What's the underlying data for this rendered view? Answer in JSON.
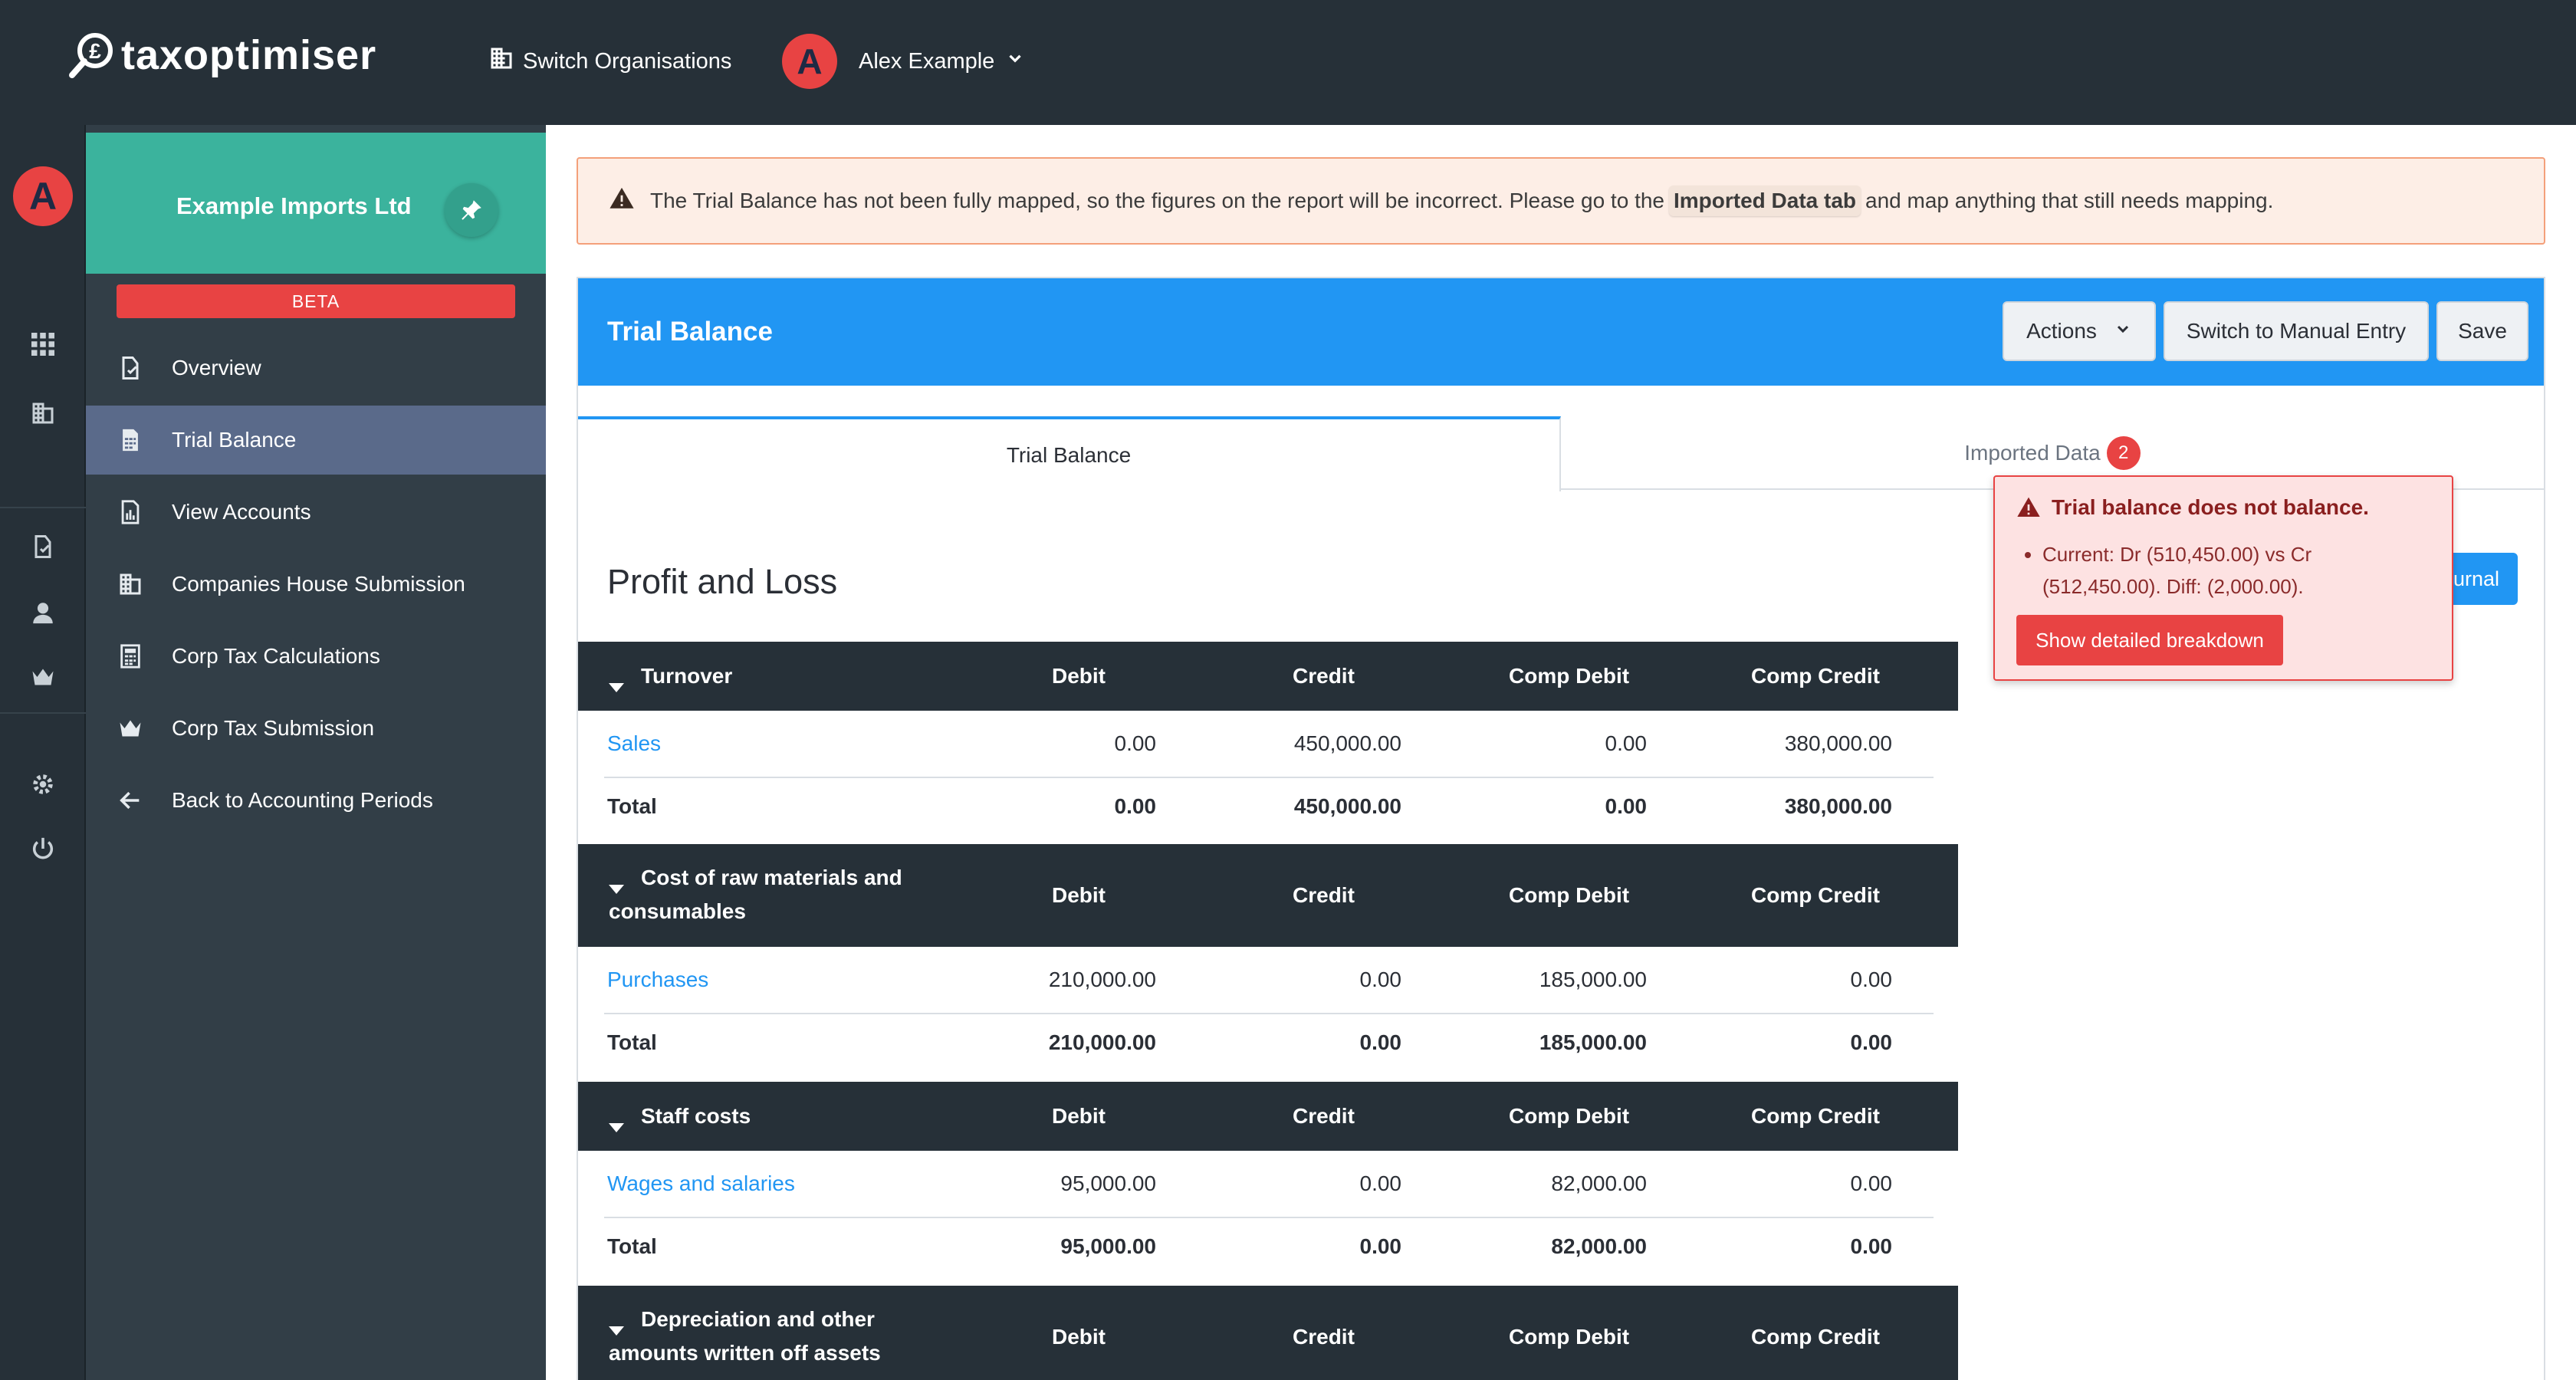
{
  "brand": {
    "name": "taxoptimiser"
  },
  "topbar": {
    "switch_org": "Switch Organisations",
    "user_name": "Alex Example",
    "user_initial": "A"
  },
  "colors": {
    "topbar": "#263038",
    "sidebar": "#323e47",
    "org_card": "#3bb39d",
    "active_nav": "#5a6a8a",
    "primary": "#2196f3",
    "danger": "#e84343",
    "warning_bg": "#fdeee6"
  },
  "sidebar": {
    "org_name": "Example Imports Ltd",
    "beta": "BETA",
    "items": [
      {
        "label": "Overview",
        "icon": "document-check-icon"
      },
      {
        "label": "Trial Balance",
        "icon": "spreadsheet-icon",
        "active": true
      },
      {
        "label": "View Accounts",
        "icon": "report-chart-icon"
      },
      {
        "label": "Companies House Submission",
        "icon": "building-icon"
      },
      {
        "label": "Corp Tax Calculations",
        "icon": "calculator-icon"
      },
      {
        "label": "Corp Tax Submission",
        "icon": "crown-icon"
      },
      {
        "label": "Back to Accounting Periods",
        "icon": "arrow-left-icon"
      }
    ]
  },
  "alert": {
    "before": "The Trial Balance has not been fully mapped, so the figures on the report will be incorrect. Please go to the",
    "link": "Imported Data tab",
    "after": "and map anything that still needs mapping."
  },
  "panel": {
    "title": "Trial Balance",
    "actions_label": "Actions",
    "manual_entry_label": "Switch to Manual Entry",
    "save_label": "Save",
    "tabs": [
      {
        "label": "Trial Balance",
        "active": true
      },
      {
        "label": "Imported Data",
        "badge": "2"
      }
    ],
    "section_title": "Profit and Loss",
    "journal_label": "urnal"
  },
  "table": {
    "columns": [
      "Debit",
      "Credit",
      "Comp Debit",
      "Comp Credit"
    ],
    "total_label": "Total",
    "groups": [
      {
        "title_lines": [
          "Turnover"
        ],
        "rows": [
          {
            "name": "Sales",
            "debit": "0.00",
            "credit": "450,000.00",
            "comp_debit": "0.00",
            "comp_credit": "380,000.00"
          }
        ],
        "total": {
          "debit": "0.00",
          "credit": "450,000.00",
          "comp_debit": "0.00",
          "comp_credit": "380,000.00"
        }
      },
      {
        "title_lines": [
          "Cost of raw materials and",
          "consumables"
        ],
        "rows": [
          {
            "name": "Purchases",
            "debit": "210,000.00",
            "credit": "0.00",
            "comp_debit": "185,000.00",
            "comp_credit": "0.00"
          }
        ],
        "total": {
          "debit": "210,000.00",
          "credit": "0.00",
          "comp_debit": "185,000.00",
          "comp_credit": "0.00"
        }
      },
      {
        "title_lines": [
          "Staff costs"
        ],
        "rows": [
          {
            "name": "Wages and salaries",
            "debit": "95,000.00",
            "credit": "0.00",
            "comp_debit": "82,000.00",
            "comp_credit": "0.00"
          }
        ],
        "total": {
          "debit": "95,000.00",
          "credit": "0.00",
          "comp_debit": "82,000.00",
          "comp_credit": "0.00"
        }
      },
      {
        "title_lines": [
          "Depreciation and other",
          "amounts written off assets"
        ]
      }
    ]
  },
  "popover": {
    "title": "Trial balance does not balance.",
    "detail": "Current: Dr (510,450.00) vs Cr (512,450.00). Diff: (2,000.00).",
    "button": "Show detailed breakdown"
  }
}
